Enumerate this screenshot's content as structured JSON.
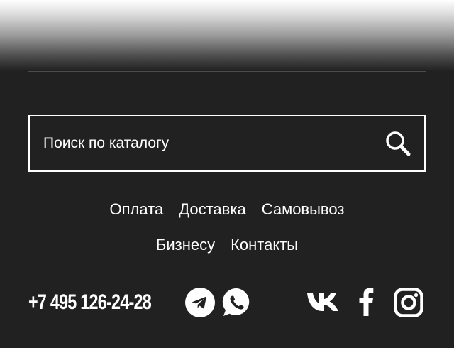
{
  "search": {
    "placeholder": "Поиск по каталогу"
  },
  "nav": {
    "row1": [
      "Оплата",
      "Доставка",
      "Самовывоз"
    ],
    "row2": [
      "Бизнесу",
      "Контакты"
    ]
  },
  "contacts": {
    "phone": "+7 495 126-24-28"
  },
  "icons": {
    "search": "search-icon",
    "telegram": "telegram-icon",
    "whatsapp": "whatsapp-icon",
    "vk": "vk-icon",
    "facebook": "facebook-icon",
    "instagram": "instagram-icon"
  },
  "colors": {
    "background": "#212121",
    "foreground": "#ffffff",
    "divider": "#4b4b4b"
  }
}
